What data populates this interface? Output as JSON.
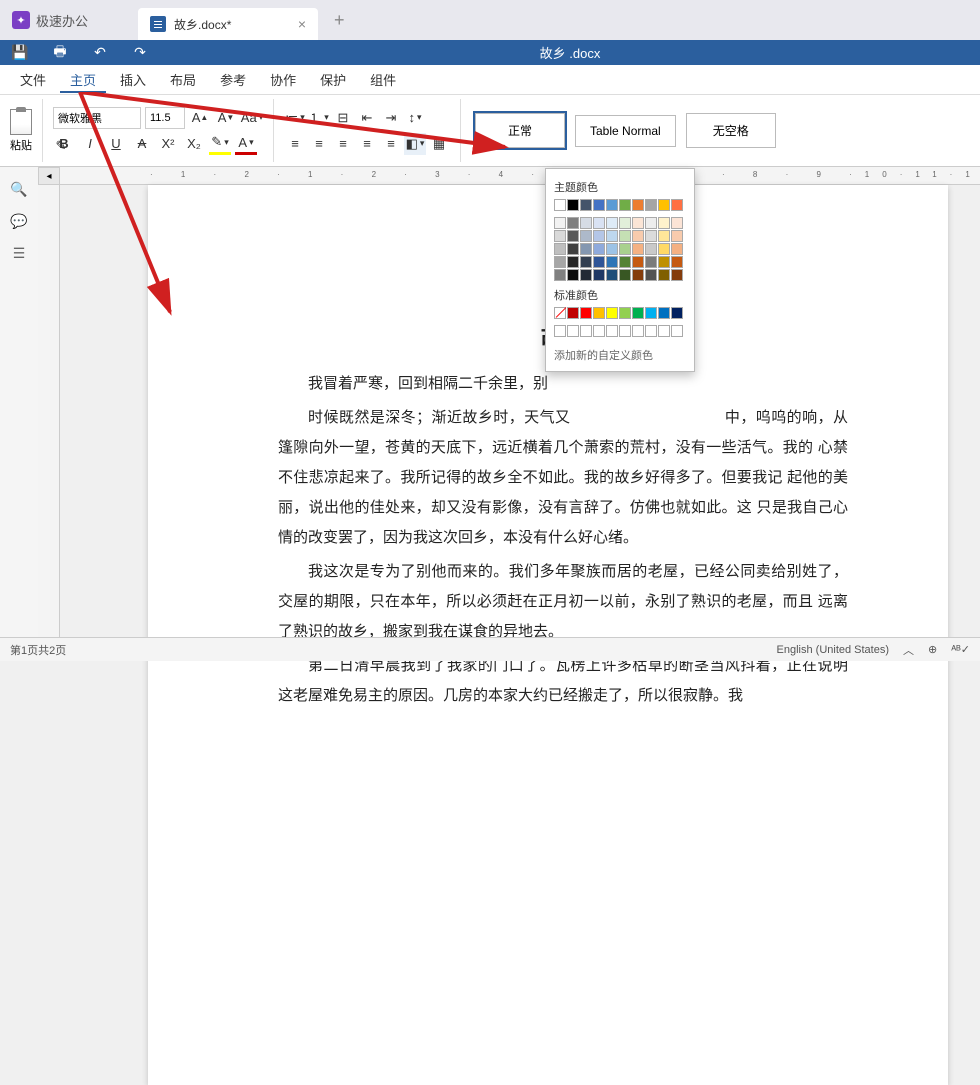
{
  "app": {
    "brand": "极速办公"
  },
  "tab": {
    "title": "故乡.docx*",
    "add": "+"
  },
  "docbar": {
    "title": "故乡 .docx"
  },
  "menu": {
    "file": "文件",
    "home": "主页",
    "insert": "插入",
    "layout": "布局",
    "ref": "参考",
    "review": "协作",
    "protect": "保护",
    "tools": "组件"
  },
  "toolbar": {
    "paste": "粘贴",
    "font_name": "微软雅黑",
    "font_size": "11.5"
  },
  "styles": {
    "normal": "正常",
    "table": "Table Normal",
    "nospacing": "无空格"
  },
  "popup": {
    "theme_label": "主题颜色",
    "std_label": "标准颜色",
    "custom_label": "添加新的自定义颜色",
    "theme_row1": [
      "#ffffff",
      "#000000",
      "#44546a",
      "#4472c4",
      "#5b9bd5",
      "#70ad47",
      "#ed7d31",
      "#a5a5a5",
      "#ffc000",
      "#ff7043"
    ],
    "theme_rows": [
      [
        "#f2f2f2",
        "#7f7f7f",
        "#d6dce5",
        "#d9e2f3",
        "#deebf7",
        "#e2efda",
        "#fbe5d6",
        "#ededed",
        "#fff2cc",
        "#fce4d6"
      ],
      [
        "#d9d9d9",
        "#595959",
        "#adb9ca",
        "#b4c6e7",
        "#bdd7ee",
        "#c5e0b4",
        "#f8cbad",
        "#dbdbdb",
        "#ffe699",
        "#f8cbad"
      ],
      [
        "#bfbfbf",
        "#404040",
        "#8497b0",
        "#8faadc",
        "#9dc3e6",
        "#a9d18e",
        "#f4b183",
        "#c9c9c9",
        "#ffd966",
        "#f4b183"
      ],
      [
        "#a6a6a6",
        "#262626",
        "#333f50",
        "#2f5597",
        "#2e75b6",
        "#548235",
        "#c55a11",
        "#7b7b7b",
        "#bf9000",
        "#c55a11"
      ],
      [
        "#808080",
        "#0d0d0d",
        "#222a35",
        "#1f3864",
        "#1f4e79",
        "#385723",
        "#843c0c",
        "#525252",
        "#806000",
        "#843c0c"
      ]
    ],
    "std_colors": [
      "nocolor",
      "#c00000",
      "#ff0000",
      "#ffc000",
      "#ffff00",
      "#92d050",
      "#00b050",
      "#00b0f0",
      "#0070c0",
      "#002060"
    ],
    "recent": [
      "",
      "",
      "",
      "",
      "",
      "",
      "",
      "",
      "",
      ""
    ]
  },
  "chart_data": null,
  "document": {
    "title": "故乡",
    "p1": "我冒着严寒，回到相隔二千余里，别",
    "p2a": "时候既然是深冬；渐近故乡时，天气又",
    "p2b": "中，呜呜的响，从 篷隙向外一望，苍黄的天底下，远近横着几个萧索的荒村，没有一些活气。我的 心禁不住悲凉起来了。我所记得的故乡全不如此。我的故乡好得多了。但要我记 起他的美丽，说出他的佳处来，却又没有影像，没有言辞了。仿佛也就如此。这 只是我自己心情的改变罢了，因为我这次回乡，本没有什么好心绪。",
    "p3": "我这次是专为了别他而来的。我们多年聚族而居的老屋，已经公同卖给别姓了， 交屋的期限，只在本年，所以必须赶在正月初一以前，永别了熟识的老屋，而且 远离了熟识的故乡，搬家到我在谋食的异地去。",
    "p4": "第二日清早晨我到了我家的门口了。瓦楞上许多枯草的断茎当风抖着，正在说明 这老屋难免易主的原因。几房的本家大约已经搬走了，所以很寂静。我"
  },
  "status": {
    "pages": "第1页共2页",
    "lang": "English (United States)"
  }
}
